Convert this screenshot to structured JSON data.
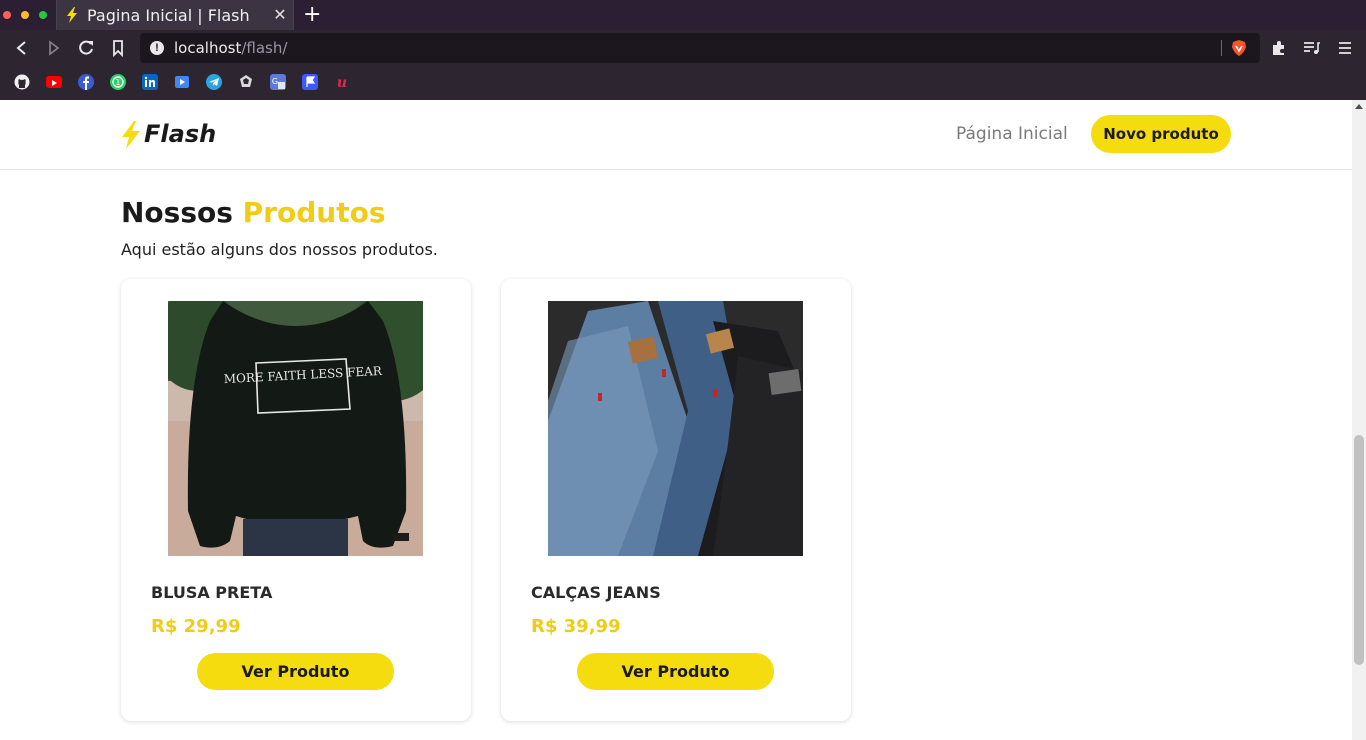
{
  "browser": {
    "tab_title": "Pagina Inicial | Flash",
    "tab_close": "✕",
    "new_tab": "+",
    "url_host": "localhost",
    "url_path": "/flash/",
    "bookmarks": [
      "github-icon",
      "youtube-icon",
      "facebook-icon",
      "whatsapp-icon",
      "linkedin-icon",
      "video-icon",
      "telegram-icon",
      "gem-icon",
      "translate-icon",
      "flag-icon",
      "unbounce-icon"
    ]
  },
  "header": {
    "logo_text": "Flash",
    "nav_home": "Página Inicial",
    "new_product_label": "Novo produto"
  },
  "section": {
    "title_main": "Nossos",
    "title_accent": "Produtos",
    "subtitle": "Aqui estão alguns dos nossos produtos."
  },
  "products": [
    {
      "name": "BLUSA PRETA",
      "price": "R$ 29,99",
      "button": "Ver Produto",
      "image": "black-sweatshirt-image",
      "print_text": "MORE FAITH LESS FEAR"
    },
    {
      "name": "CALÇAS JEANS",
      "price": "R$ 39,99",
      "button": "Ver Produto",
      "image": "folded-jeans-image"
    }
  ],
  "colors": {
    "accent": "#f5dc0f",
    "accent_text": "#f0cc15",
    "chrome_dark": "#2d2630",
    "tab_bar": "#2c1f33"
  }
}
